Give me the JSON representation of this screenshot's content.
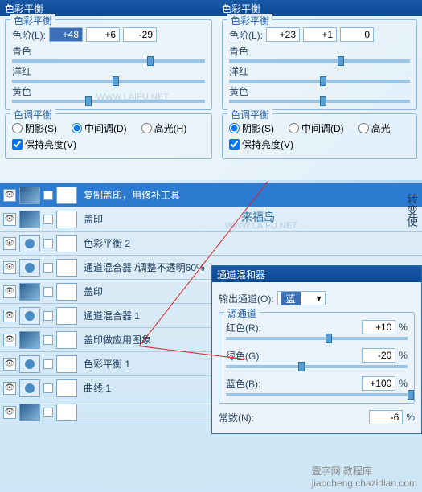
{
  "panel1": {
    "title": "色彩平衡",
    "section": "色彩平衡",
    "levels_label": "色阶(L):",
    "v1": "+48",
    "v2": "+6",
    "v3": "-29",
    "c1": "青色",
    "c2": "洋红",
    "c3": "黄色",
    "tone_section": "色调平衡",
    "r1": "阴影(S)",
    "r2": "中间调(D)",
    "r3": "高光(H)",
    "preserve": "保持亮度(V)"
  },
  "panel2": {
    "title": "色彩平衡",
    "section": "色彩平衡",
    "levels_label": "色阶(L):",
    "v1": "+23",
    "v2": "+1",
    "v3": "0",
    "c1": "青色",
    "c2": "洋红",
    "c3": "黄色",
    "tone_section": "色调平衡",
    "r1": "阴影(S)",
    "r2": "中间调(D)",
    "r3": "高光",
    "preserve": "保持亮度(V)"
  },
  "layers": [
    {
      "name": "复制盖印，用修补工具",
      "type": "photo",
      "active": true
    },
    {
      "name": "盖印",
      "type": "photo"
    },
    {
      "name": "色彩平衡 2",
      "type": "adj"
    },
    {
      "name": "通道混合器 /调整不透明60%",
      "type": "adj"
    },
    {
      "name": "盖印",
      "type": "photo"
    },
    {
      "name": "通道混合器 1",
      "type": "adj"
    },
    {
      "name": "盖印做应用图象",
      "type": "photo"
    },
    {
      "name": "色彩平衡 1",
      "type": "adj"
    },
    {
      "name": "曲线 1",
      "type": "adj"
    },
    {
      "name": "",
      "type": "photo"
    }
  ],
  "chmix": {
    "title": "通道混和器",
    "out_label": "输出通道(O):",
    "out_value": "蓝",
    "src_section": "源通道",
    "red_label": "红色(R):",
    "red_val": "+10",
    "green_label": "绿色(G):",
    "green_val": "-20",
    "blue_label": "蓝色(B):",
    "blue_val": "+100",
    "const_label": "常数(N):",
    "const_val": "-6",
    "pct": "%"
  },
  "watermarks": {
    "laifu": "来福岛",
    "laifu_url": "WWW.LAIFU.NET",
    "site": "壹字网 教程库",
    "site_url": "jiaocheng.chazidian.com"
  },
  "side_text": "转变使"
}
